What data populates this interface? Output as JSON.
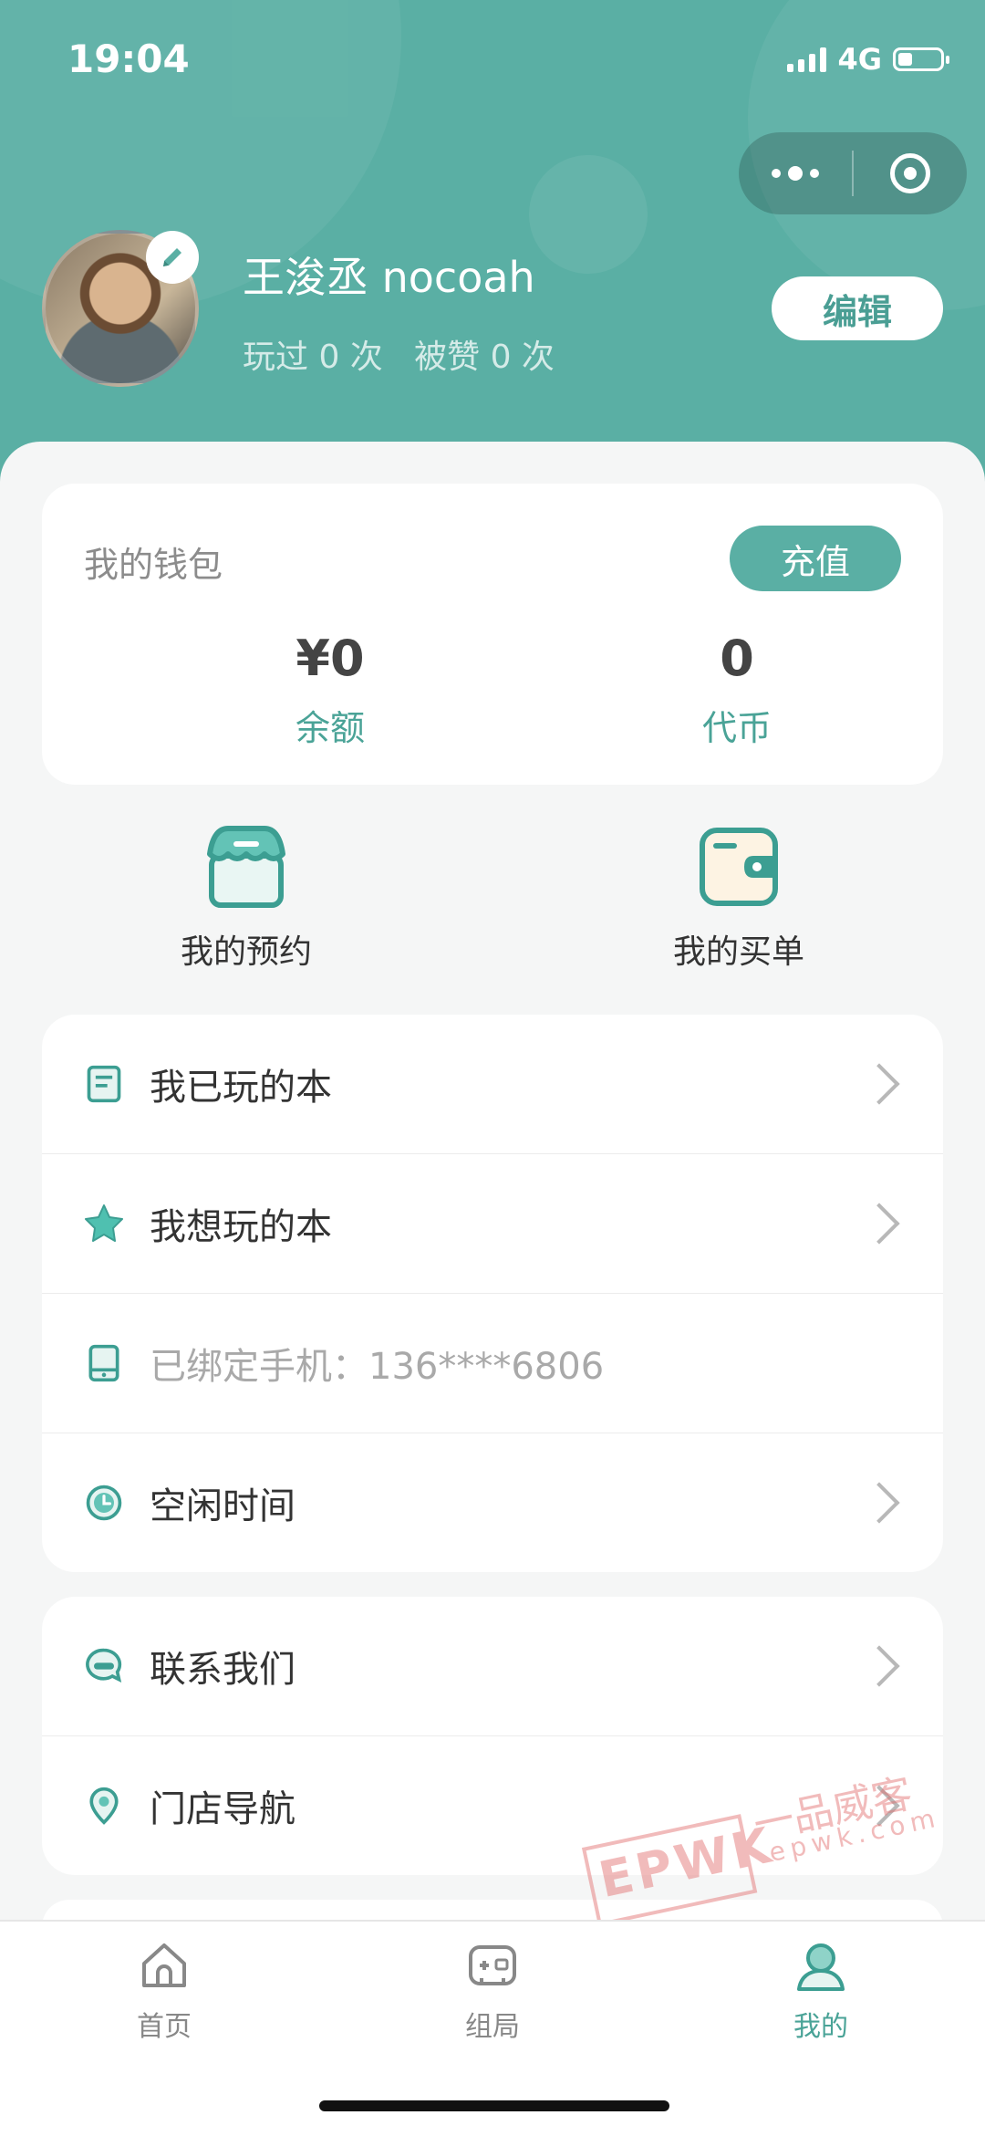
{
  "status_bar": {
    "time": "19:04",
    "network": "4G",
    "battery_level": 0.35
  },
  "header": {
    "user_name": "王浚丞 nocoah",
    "stats": "玩过 0 次   被赞 0 次",
    "edit_label": "编辑"
  },
  "wallet": {
    "title": "我的钱包",
    "recharge_label": "充值",
    "balance_value": "¥0",
    "balance_label": "余额",
    "coins_value": "0",
    "coins_label": "代币"
  },
  "quick_actions": [
    {
      "label": "我的预约",
      "icon": "shop-icon"
    },
    {
      "label": "我的买单",
      "icon": "wallet-icon"
    }
  ],
  "menu_group_1": [
    {
      "label": "我已玩的本",
      "icon": "book-icon"
    },
    {
      "label": "我想玩的本",
      "icon": "star-icon"
    },
    {
      "label": "已绑定手机：136****6806",
      "icon": "phone-icon"
    },
    {
      "label": "空闲时间",
      "icon": "clock-icon"
    }
  ],
  "menu_group_2": [
    {
      "label": "联系我们",
      "icon": "chat-icon"
    },
    {
      "label": "门店导航",
      "icon": "location-icon"
    }
  ],
  "tabs": [
    {
      "label": "首页",
      "icon": "home-icon"
    },
    {
      "label": "组局",
      "icon": "gamepad-icon"
    },
    {
      "label": "我的",
      "icon": "user-icon"
    }
  ],
  "watermark": {
    "text": "EPWK",
    "cn": "一品威客",
    "url": "epwk.com"
  },
  "colors": {
    "accent": "#5aafa4",
    "accent_text": "#4aa397",
    "background": "#f5f6f6"
  }
}
